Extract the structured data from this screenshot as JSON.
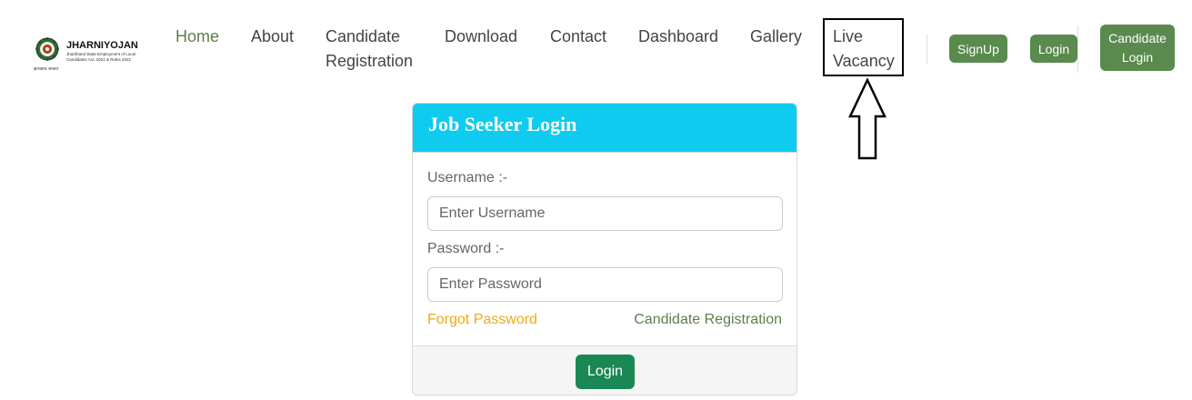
{
  "header": {
    "logo": {
      "title": "JHARNIYOJAN",
      "subtitle": "Jharkhand State Employment of Local Candidates Act, 2021 & Rules 2022",
      "tagline": "झारखण्ड सरकार"
    },
    "nav": {
      "home": "Home",
      "about": "About",
      "candidate_registration_line1": "Candidate",
      "candidate_registration_line2": "Registration",
      "download": "Download",
      "contact": "Contact",
      "dashboard": "Dashboard",
      "gallery": "Gallery",
      "live_vacancy_line1": "Live",
      "live_vacancy_line2": "Vacancy",
      "active": "Home"
    },
    "buttons": {
      "signup": "SignUp",
      "login": "Login",
      "candidate_login_line1": "Candidate",
      "candidate_login_line2": "Login"
    }
  },
  "login_card": {
    "title": "Job Seeker Login",
    "username_label": "Username :-",
    "username_placeholder": "Enter Username",
    "username_value": "",
    "password_label": "Password :-",
    "password_placeholder": "Enter Password",
    "password_value": "",
    "forgot_password": "Forgot Password",
    "candidate_registration": "Candidate Registration",
    "submit": "Login"
  },
  "annotation": {
    "box_color": "#000000",
    "arrow_icon": "up-arrow-outline",
    "highlighted_item": "Live Vacancy"
  },
  "colors": {
    "header_accent": "#0fcbef",
    "nav_active": "#5f7e4a",
    "nav_button": "#5a8a4e",
    "submit_button": "#1a8754",
    "forgot_link": "#f0a818"
  }
}
